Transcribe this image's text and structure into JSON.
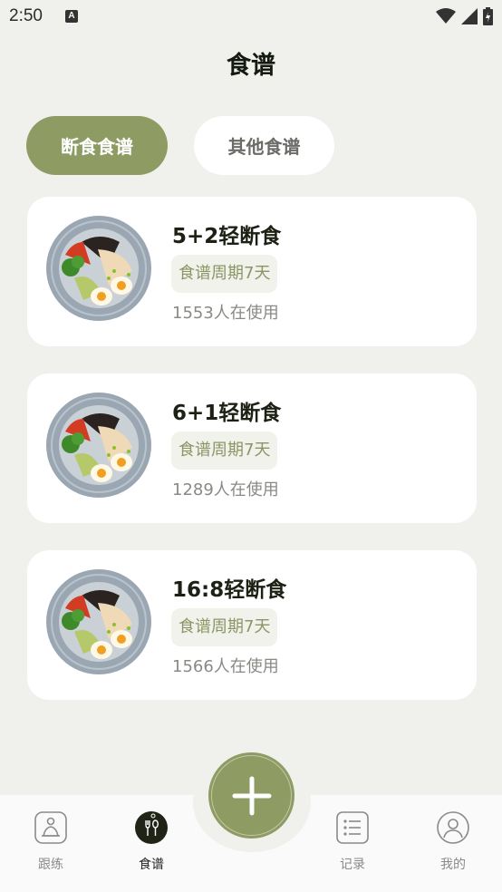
{
  "status": {
    "time": "2:50",
    "a_icon": "A"
  },
  "page": {
    "title": "食谱"
  },
  "tabs": [
    {
      "label": "断食食谱",
      "active": true
    },
    {
      "label": "其他食谱",
      "active": false
    }
  ],
  "recipes": [
    {
      "name": "5+2轻断食",
      "tag": "食谱周期7天",
      "users": "1553人在使用",
      "image": "salad-bowl-image"
    },
    {
      "name": "6+1轻断食",
      "tag": "食谱周期7天",
      "users": "1289人在使用",
      "image": "salad-bowl-image"
    },
    {
      "name": "16:8轻断食",
      "tag": "食谱周期7天",
      "users": "1566人在使用",
      "image": "salad-bowl-image"
    }
  ],
  "nav": [
    {
      "label": "跟练",
      "icon": "meditation-icon",
      "active": false
    },
    {
      "label": "食谱",
      "icon": "fork-spoon-icon",
      "active": true
    },
    {
      "label": "记录",
      "icon": "list-icon",
      "active": false
    },
    {
      "label": "我的",
      "icon": "profile-icon",
      "active": false
    }
  ],
  "fab": {
    "icon": "plus-icon"
  },
  "colors": {
    "accent": "#8e9b63",
    "background": "#f0f1ed",
    "card": "#ffffff"
  }
}
